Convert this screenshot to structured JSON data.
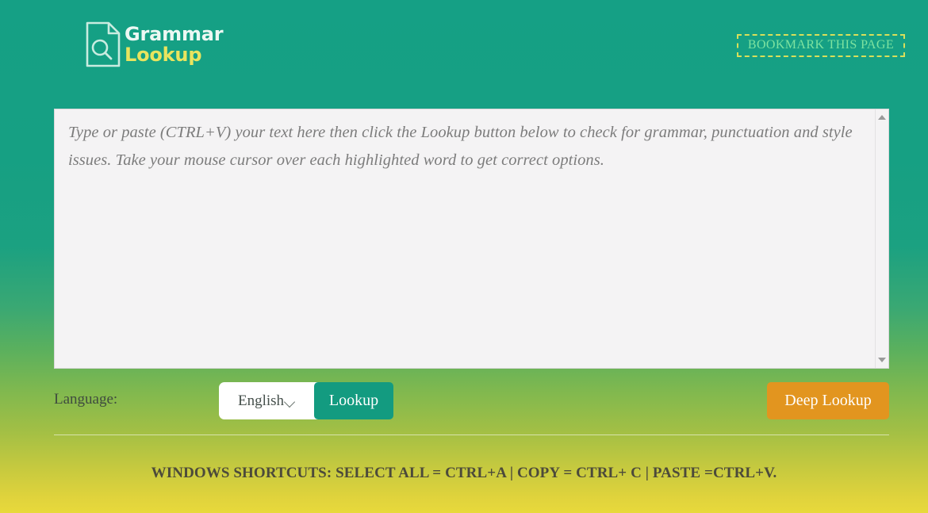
{
  "header": {
    "logo": {
      "icon": "document-search-icon",
      "line1": "Grammar",
      "line2": "Lookup"
    },
    "bookmark_label": "BOOKMARK THIS PAGE"
  },
  "editor": {
    "placeholder": "Type or paste (CTRL+V) your text here then click the Lookup button below to check for grammar, punctuation and style issues. Take your mouse cursor over each highlighted word to get correct options.",
    "value": "",
    "scrollbar": {
      "up_icon": "scroll-up-arrow-icon",
      "down_icon": "scroll-down-arrow-icon"
    }
  },
  "controls": {
    "language_label": "Language:",
    "language_selected": "English",
    "language_options": [
      "English"
    ],
    "chevron_icon": "chevron-down-icon",
    "lookup_label": "Lookup",
    "deep_lookup_label": "Deep Lookup"
  },
  "footer": {
    "shortcuts": "WINDOWS SHORTCUTS: SELECT ALL = CTRL+A | COPY = CTRL+ C | PASTE =CTRL+V."
  },
  "colors": {
    "gradient_top": "#15a085",
    "gradient_bottom": "#e8d93b",
    "lookup_button": "#139b80",
    "deep_lookup_button": "#e2951f",
    "logo_accent": "#e9e45e",
    "bookmark_border": "#d8df5a",
    "bookmark_text": "#7ee39f",
    "editor_background": "#f4f3f4"
  }
}
